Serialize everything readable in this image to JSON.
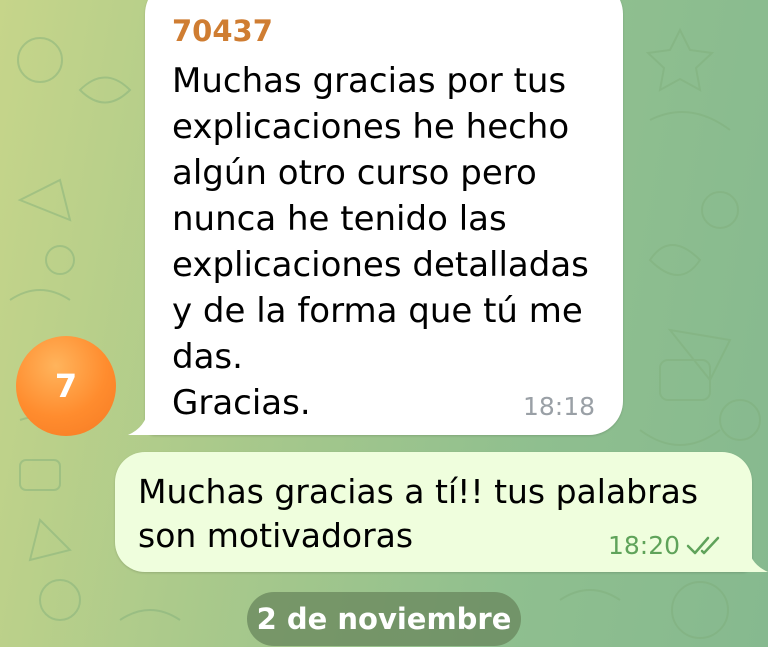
{
  "chat": {
    "incoming": {
      "sender": "70437",
      "text": "Muchas gracias por tus\nexplicaciones he hecho\nalgún otro curso pero\nnunca he tenido las\nexplicaciones detalladas\ny de la forma que tú me\ndas.\nGracias.",
      "time": "18:18"
    },
    "avatar_letter": "7",
    "outgoing": {
      "text": "Muchas gracias a tí!! tus palabras\nson motivadoras",
      "time": "18:20",
      "status_icon": "double-check-read-icon"
    },
    "date_separator": "2 de noviembre"
  },
  "colors": {
    "sender_name": "#cf7d32",
    "avatar": "#ff8c2e",
    "outgoing_bubble": "#effedd",
    "outgoing_time": "#5fa35a"
  }
}
